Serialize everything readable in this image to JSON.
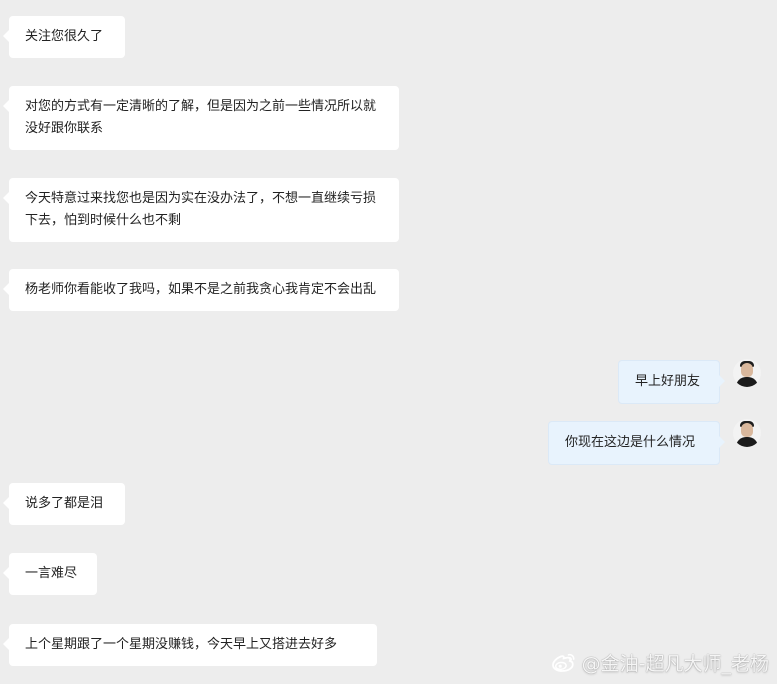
{
  "messages": [
    {
      "side": "left",
      "text": "关注您很久了"
    },
    {
      "side": "left",
      "text": "对您的方式有一定清晰的了解，但是因为之前一些情况所以就没好跟你联系"
    },
    {
      "side": "left",
      "text": "今天特意过来找您也是因为实在没办法了，不想一直继续亏损下去，怕到时候什么也不剩"
    },
    {
      "side": "left",
      "text": "杨老师你看能收了我吗，如果不是之前我贪心我肯定不会出乱"
    },
    {
      "side": "right",
      "text": "早上好朋友"
    },
    {
      "side": "right",
      "text": "你现在这边是什么情况"
    },
    {
      "side": "left",
      "text": "说多了都是泪"
    },
    {
      "side": "left",
      "text": "一言难尽"
    },
    {
      "side": "left",
      "text": "上个星期跟了一个星期没赚钱，今天早上又搭进去好多"
    }
  ],
  "watermark": {
    "text": "@金油-超凡大师_老杨",
    "icon": "weibo-icon"
  }
}
